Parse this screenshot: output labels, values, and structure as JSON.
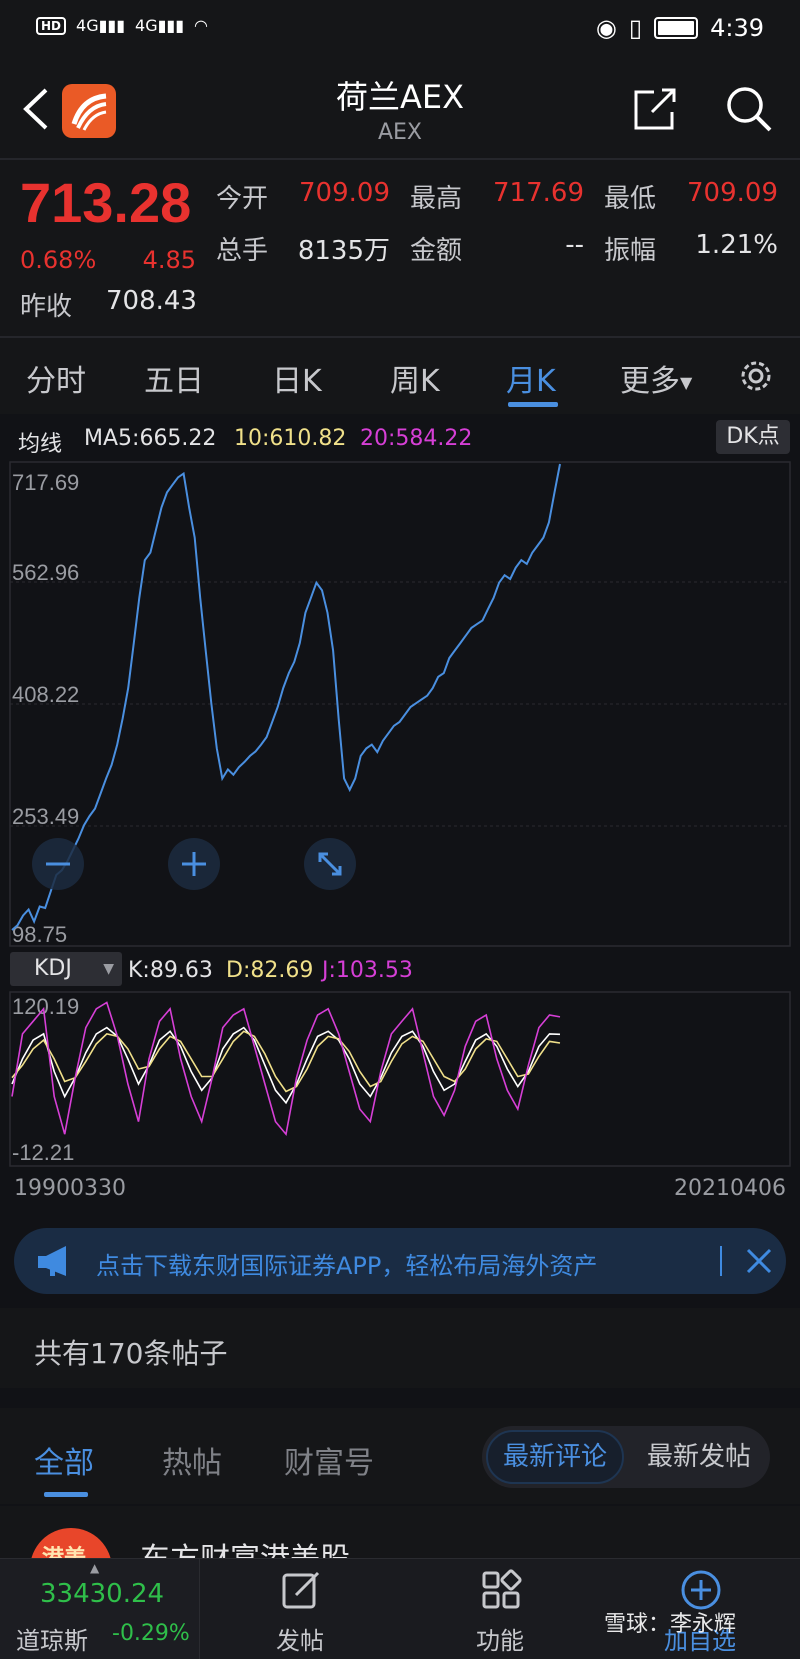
{
  "status_bar": {
    "badge": "HD",
    "signal1": "4G",
    "signal2": "4G",
    "time": "4:39"
  },
  "header": {
    "title": "荷兰AEX",
    "subtitle": "AEX"
  },
  "quote": {
    "price": "713.28",
    "change_pct": "0.68%",
    "change_val": "4.85",
    "prev_close_label": "昨收",
    "prev_close": "708.43",
    "open_label": "今开",
    "open": "709.09",
    "high_label": "最高",
    "high": "717.69",
    "low_label": "最低",
    "low": "709.09",
    "volume_label": "总手",
    "volume": "8135万",
    "amount_label": "金额",
    "amount": "--",
    "amplitude_label": "振幅",
    "amplitude": "1.21%"
  },
  "tabs": [
    {
      "label": "分时"
    },
    {
      "label": "五日"
    },
    {
      "label": "日K"
    },
    {
      "label": "周K"
    },
    {
      "label": "月K"
    },
    {
      "label": "更多"
    }
  ],
  "ma": {
    "label": "均线",
    "ma5": "MA5:665.22",
    "ma10": "10:610.82",
    "ma20": "20:584.22",
    "dk_button": "DK点"
  },
  "kdj": {
    "selector": "KDJ",
    "k": "K:89.63",
    "d": "D:82.69",
    "j": "J:103.53"
  },
  "dates": {
    "start": "19900330",
    "end": "20210406"
  },
  "banner": {
    "text": "点击下载东财国际证券APP，轻松布局海外资产"
  },
  "posts": {
    "count_text": "共有170条帖子",
    "tabs": [
      {
        "label": "全部"
      },
      {
        "label": "热帖"
      },
      {
        "label": "财富号"
      }
    ],
    "sort_active": "最新评论",
    "sort_other": "最新发帖",
    "first_author": "东方财富港美股",
    "first_avatar": "港美"
  },
  "bottom_bar": {
    "index_value": "33430.24",
    "index_name": "道琼斯",
    "index_change": "-0.29%",
    "items": [
      {
        "label": "发帖"
      },
      {
        "label": "功能"
      },
      {
        "label": "加自选"
      }
    ],
    "watermark": "雪球：李永辉"
  },
  "colors": {
    "up": "#e8322f",
    "down": "#2fbf4a",
    "accent": "#4a8fe0",
    "k_line": "#ffffff",
    "d_line": "#f0e08a",
    "j_line": "#d63fd6",
    "price_line": "#4a8fe0"
  },
  "chart_data": [
    {
      "type": "line",
      "title": "",
      "series": [
        {
          "name": "",
          "values": [
            98.75,
            105,
            118,
            126,
            110,
            130,
            128,
            150,
            172,
            178,
            190,
            205,
            220,
            238,
            250,
            260,
            280,
            300,
            318,
            345,
            380,
            420,
            480,
            540,
            590,
            600,
            630,
            660,
            680,
            690,
            700,
            705,
            660,
            620,
            540,
            470,
            400,
            340,
            300,
            312,
            305,
            315,
            322,
            330,
            336,
            345,
            355,
            375,
            395,
            420,
            440,
            455,
            480,
            520,
            540,
            560,
            550,
            520,
            470,
            380,
            300,
            285,
            300,
            330,
            340,
            345,
            335,
            350,
            360,
            370,
            375,
            385,
            395,
            400,
            405,
            410,
            420,
            435,
            440,
            460,
            470,
            480,
            490,
            500,
            505,
            510,
            525,
            540,
            560,
            570,
            565,
            580,
            590,
            585,
            600,
            610,
            620,
            640,
            680,
            717.69
          ]
        }
      ],
      "ylim": [
        98.75,
        717.69
      ],
      "y_ticks": [
        "717.69",
        "562.96",
        "408.22",
        "253.49",
        "98.75"
      ],
      "xlabel": "",
      "ylabel": ""
    },
    {
      "type": "line",
      "title": "KDJ",
      "series": [
        {
          "name": "K",
          "values": [
            50,
            70,
            85,
            90,
            60,
            40,
            55,
            75,
            90,
            95,
            88,
            70,
            50,
            65,
            85,
            92,
            80,
            60,
            45,
            55,
            78,
            90,
            95,
            85,
            65,
            45,
            35,
            50,
            70,
            88,
            92,
            85,
            70,
            50,
            40,
            55,
            75,
            88,
            92,
            80,
            60,
            45,
            50,
            68,
            85,
            90,
            80,
            62,
            48,
            60,
            80,
            90,
            89.63
          ]
        },
        {
          "name": "D",
          "values": [
            55,
            65,
            78,
            85,
            70,
            52,
            55,
            68,
            82,
            90,
            88,
            78,
            62,
            64,
            78,
            88,
            84,
            70,
            56,
            56,
            70,
            84,
            92,
            88,
            74,
            56,
            44,
            48,
            62,
            80,
            88,
            86,
            76,
            60,
            48,
            52,
            68,
            82,
            88,
            84,
            70,
            56,
            52,
            62,
            78,
            86,
            84,
            70,
            56,
            58,
            72,
            84,
            82.69
          ]
        },
        {
          "name": "J",
          "values": [
            40,
            90,
            100,
            110,
            40,
            10,
            55,
            95,
            110,
            115,
            88,
            50,
            20,
            70,
            100,
            110,
            70,
            40,
            20,
            55,
            95,
            105,
            110,
            80,
            50,
            20,
            10,
            55,
            85,
            105,
            110,
            90,
            60,
            30,
            20,
            60,
            90,
            100,
            110,
            75,
            40,
            25,
            45,
            80,
            100,
            105,
            70,
            45,
            30,
            65,
            95,
            105,
            103.53
          ]
        }
      ],
      "ylim": [
        -12.21,
        120.19
      ],
      "y_ticks": [
        "120.19",
        "-12.21"
      ]
    }
  ]
}
